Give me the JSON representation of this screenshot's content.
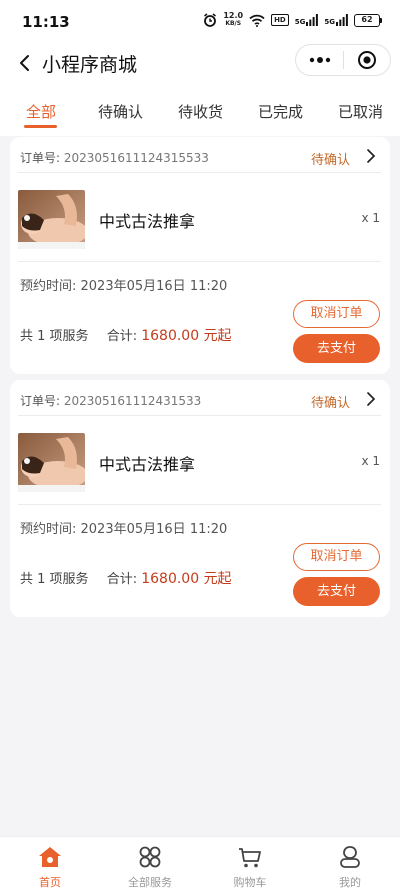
{
  "status_bar": {
    "time": "11:13",
    "net_speed_value": "12.0",
    "net_speed_unit": "KB/S",
    "hd_badge": "HD",
    "signal_label_1": "5G",
    "signal_label_2": "5G",
    "battery": "62",
    "icons": [
      "alarm-icon",
      "wifi-icon",
      "signal-icon",
      "battery-icon"
    ]
  },
  "nav": {
    "title": "小程序商城",
    "icons": [
      "back-icon",
      "more-icon",
      "close-target-icon"
    ]
  },
  "tabs": [
    {
      "label": "全部",
      "active": true
    },
    {
      "label": "待确认",
      "active": false
    },
    {
      "label": "待收货",
      "active": false
    },
    {
      "label": "已完成",
      "active": false
    },
    {
      "label": "已取消",
      "active": false
    }
  ],
  "orders": [
    {
      "order_label": "订单号:",
      "order_no": "2023051611124315533",
      "status": "待确认",
      "product_name": "中式古法推拿",
      "quantity": "x 1",
      "appointment": "预约时间: 2023年05月16日 11:20",
      "service_count": "共 1 项服务",
      "total_label": "合计:",
      "total_price": "1680.00 元起",
      "cancel_label": "取消订单",
      "pay_label": "去支付"
    },
    {
      "order_label": "订单号:",
      "order_no": "202305161112431533",
      "status": "待确认",
      "product_name": "中式古法推拿",
      "quantity": "x 1",
      "appointment": "预约时间: 2023年05月16日 11:20",
      "service_count": "共 1 项服务",
      "total_label": "合计:",
      "total_price": "1680.00 元起",
      "cancel_label": "取消订单",
      "pay_label": "去支付"
    }
  ],
  "tabbar": [
    {
      "label": "首页",
      "icon": "home-icon",
      "active": true
    },
    {
      "label": "全部服务",
      "icon": "grid-icon",
      "active": false
    },
    {
      "label": "购物车",
      "icon": "cart-icon",
      "active": false
    },
    {
      "label": "我的",
      "icon": "user-icon",
      "active": false
    }
  ],
  "colors": {
    "accent": "#e8602c",
    "price": "#c43c1c",
    "status": "#c46a2a",
    "background": "#f4f4f6"
  }
}
